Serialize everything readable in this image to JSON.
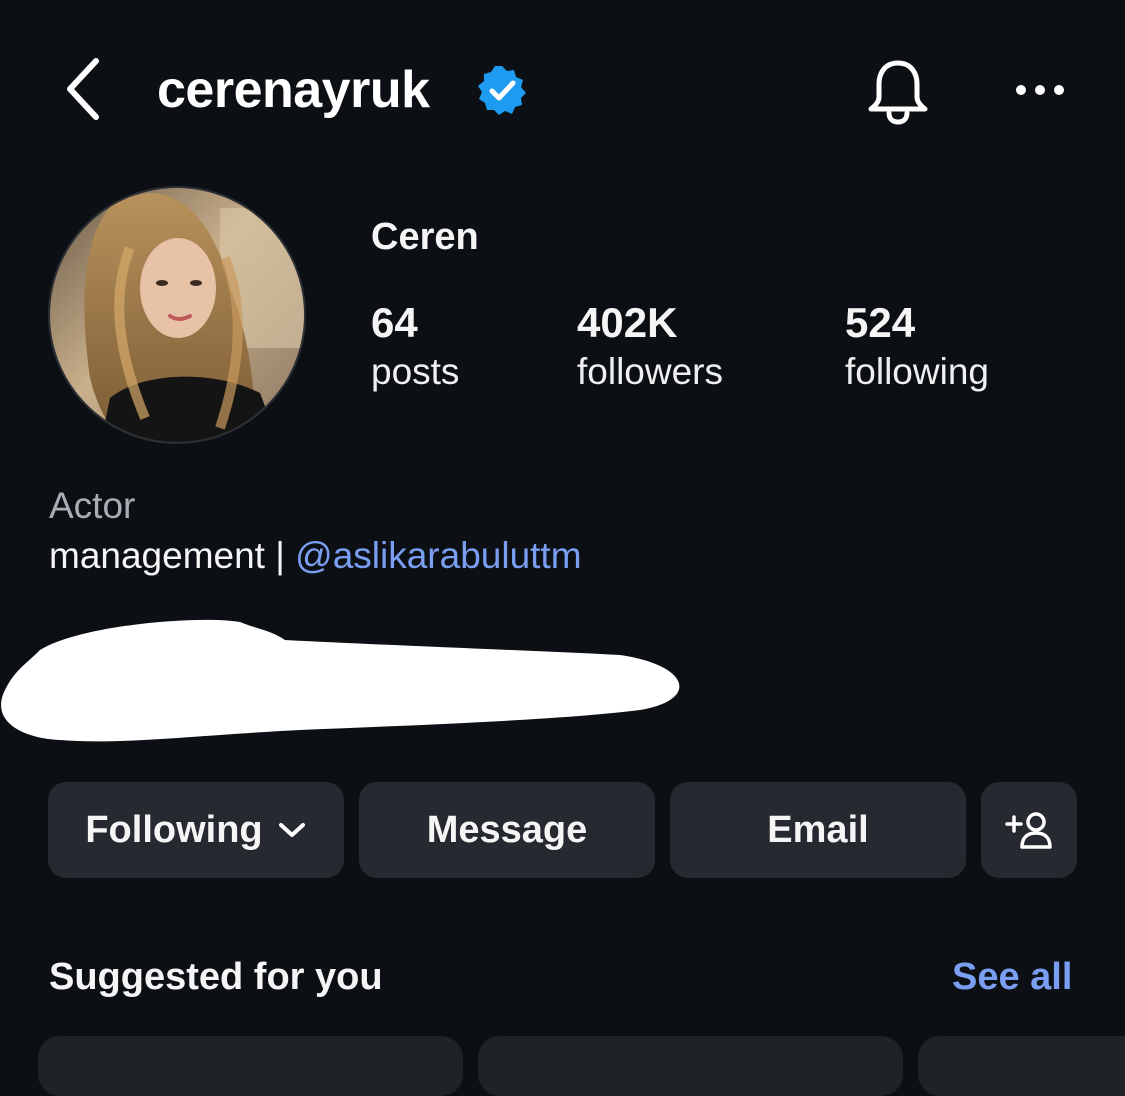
{
  "header": {
    "username": "cerenayruk",
    "back_icon": "chevron-left-icon",
    "verified_icon": "verified-badge-icon",
    "bell_icon": "bell-icon",
    "more_icon": "more-horizontal-icon"
  },
  "profile": {
    "display_name": "Ceren",
    "stats": {
      "posts": {
        "value": "64",
        "label": "posts"
      },
      "followers": {
        "value": "402K",
        "label": "followers"
      },
      "following": {
        "value": "524",
        "label": "following"
      }
    }
  },
  "bio": {
    "category": "Actor",
    "management_prefix": "management | ",
    "mention": "@aslikarabuluttm"
  },
  "actions": {
    "following_label": "Following",
    "message_label": "Message",
    "email_label": "Email",
    "add_user_icon": "add-person-icon"
  },
  "suggested": {
    "title": "Suggested for you",
    "see_all": "See all"
  },
  "colors": {
    "background": "#0c1014",
    "button_bg": "#262a30",
    "link": "#7a9ef2",
    "verified": "#1d9bf0",
    "muted_text": "#a8aeb5"
  }
}
